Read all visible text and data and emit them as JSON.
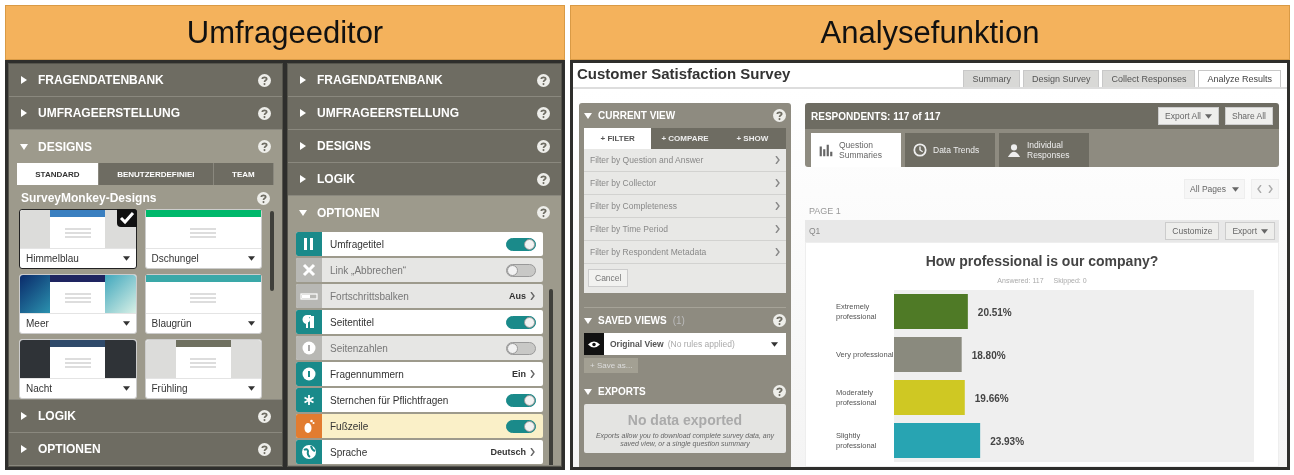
{
  "sections": [
    {
      "title": "Umfrageeditor"
    },
    {
      "title": "Analysefunktion"
    }
  ],
  "editor_panels": [
    {
      "accordion": [
        {
          "label": "FRAGENDATENBANK",
          "expanded": false
        },
        {
          "label": "UMFRAGEERSTELLUNG",
          "expanded": false
        },
        {
          "label": "DESIGNS",
          "expanded": true,
          "designs": {
            "tabs": [
              {
                "label": "STANDARD",
                "selected": true
              },
              {
                "label": "BENUTZERDEFINIEI",
                "selected": false
              },
              {
                "label": "TEAM",
                "selected": false
              }
            ],
            "heading": "SurveyMonkey-Designs",
            "themes": [
              {
                "name": "Himmelblau",
                "selected": true,
                "kind": "light",
                "color": "#3a7fc0"
              },
              {
                "name": "Dschungel",
                "selected": false,
                "kind": "plain",
                "color": "#00b86b"
              },
              {
                "name": "Meer",
                "selected": false,
                "kind": "ocean",
                "color": "#1e2460"
              },
              {
                "name": "Blaugrün",
                "selected": false,
                "kind": "plain",
                "color": "#3aa8a8"
              },
              {
                "name": "Nacht",
                "selected": false,
                "kind": "dark",
                "color": "#2f4a6a"
              },
              {
                "name": "Frühling",
                "selected": false,
                "kind": "light",
                "color": "#6f7060"
              }
            ]
          }
        },
        {
          "label": "LOGIK",
          "expanded": false
        },
        {
          "label": "OPTIONEN",
          "expanded": false
        }
      ]
    },
    {
      "accordion": [
        {
          "label": "FRAGENDATENBANK",
          "expanded": false
        },
        {
          "label": "UMFRAGEERSTELLUNG",
          "expanded": false
        },
        {
          "label": "DESIGNS",
          "expanded": false
        },
        {
          "label": "LOGIK",
          "expanded": false
        },
        {
          "label": "OPTIONEN",
          "expanded": true,
          "options": [
            {
              "label": "Umfragetitel",
              "kind": "toggle",
              "on": true,
              "disabled": false,
              "highlighted": false
            },
            {
              "label": "Link „Abbrechen“",
              "kind": "toggle",
              "on": false,
              "disabled": true,
              "highlighted": false
            },
            {
              "label": "Fortschrittsbalken",
              "kind": "value",
              "value": "Aus",
              "disabled": true,
              "highlighted": false
            },
            {
              "label": "Seitentitel",
              "kind": "toggle",
              "on": true,
              "disabled": false,
              "highlighted": false
            },
            {
              "label": "Seitenzahlen",
              "kind": "toggle",
              "on": false,
              "disabled": true,
              "highlighted": false
            },
            {
              "label": "Fragennummern",
              "kind": "value",
              "value": "Ein",
              "disabled": false,
              "highlighted": false
            },
            {
              "label": "Sternchen für Pflichtfragen",
              "kind": "toggle",
              "on": true,
              "disabled": false,
              "highlighted": false
            },
            {
              "label": "Fußzeile",
              "kind": "toggle",
              "on": true,
              "disabled": false,
              "highlighted": true
            },
            {
              "label": "Sprache",
              "kind": "value",
              "value": "Deutsch",
              "disabled": false,
              "highlighted": false
            }
          ]
        }
      ]
    }
  ],
  "analysis": {
    "survey_title": "Customer Satisfaction Survey",
    "tabs": [
      {
        "label": "Summary",
        "selected": false
      },
      {
        "label": "Design Survey",
        "selected": false
      },
      {
        "label": "Collect Responses",
        "selected": false
      },
      {
        "label": "Analyze Results",
        "selected": true
      }
    ],
    "sidebar": {
      "current_view": {
        "title": "CURRENT VIEW",
        "tabs": [
          {
            "label": "+ FILTER",
            "selected": true
          },
          {
            "label": "+ COMPARE",
            "selected": false
          },
          {
            "label": "+ SHOW",
            "selected": false
          }
        ],
        "filters": [
          "Filter by Question and Answer",
          "Filter by Collector",
          "Filter by Completeness",
          "Filter by Time Period",
          "Filter by Respondent Metadata"
        ],
        "cancel": "Cancel"
      },
      "saved_views": {
        "title": "SAVED VIEWS",
        "count": "(1)",
        "view": "Original View",
        "view_note": "(No rules applied)",
        "save_as": "+ Save as..."
      },
      "exports": {
        "title": "EXPORTS",
        "empty_title": "No data exported",
        "empty_text": "Exports allow you to download complete survey data, any saved view, or a single question summary"
      }
    },
    "main": {
      "respondents": "RESPONDENTS: 117 of 117",
      "buttons": [
        {
          "label": "Export All",
          "dropdown": true
        },
        {
          "label": "Share All",
          "dropdown": false
        }
      ],
      "view_tabs": [
        {
          "label": "Question Summaries",
          "selected": true
        },
        {
          "label": "Data Trends",
          "selected": false
        },
        {
          "label": "Individual Responses",
          "selected": false
        }
      ],
      "pages_dropdown": "All Pages",
      "page_label": "PAGE 1",
      "question": {
        "number": "Q1",
        "buttons": [
          {
            "label": "Customize",
            "dropdown": false
          },
          {
            "label": "Export",
            "dropdown": true
          }
        ],
        "title": "How professional is our company?",
        "answered": "Answered: 117",
        "skipped": "Skipped: 0",
        "bars": [
          {
            "color": "#4f7a26"
          },
          {
            "color": "#8a8a7e"
          },
          {
            "color": "#cfc823"
          },
          {
            "color": "#28a4b2"
          }
        ],
        "chart_data": {
          "type": "bar",
          "orientation": "horizontal",
          "categories": [
            "Extremely professional",
            "Very professional",
            "Moderately professional",
            "Slightly professional"
          ],
          "values": [
            20.51,
            18.8,
            19.66,
            23.93
          ],
          "xlim": [
            0,
            100
          ],
          "value_labels": [
            "20.51%",
            "18.80%",
            "19.66%",
            "23.93%"
          ]
        }
      }
    }
  }
}
